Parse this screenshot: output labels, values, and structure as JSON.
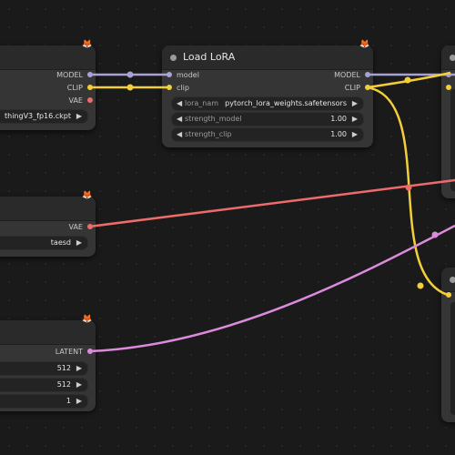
{
  "colors": {
    "model": "#a8a2d4",
    "clip": "#f2cf3a",
    "vae": "#ee6b6b",
    "latent": "#dc8bdc",
    "canvas": "#1a1a1a",
    "node": "#353535"
  },
  "icons": {
    "node_badge": "fox-icon"
  },
  "checkpoint_node": {
    "outputs": {
      "model": "MODEL",
      "clip": "CLIP",
      "vae": "VAE"
    },
    "ckpt_value": "thingV3_fp16.ckpt"
  },
  "lora_node": {
    "title": "Load LoRA",
    "inputs": {
      "model": "model",
      "clip": "clip"
    },
    "outputs": {
      "model": "MODEL",
      "clip": "CLIP"
    },
    "widgets": {
      "lora_name": {
        "label": "lora_nam",
        "value": "pytorch_lora_weights.safetensors"
      },
      "strength_model": {
        "label": "strength_model",
        "value": "1.00"
      },
      "strength_clip": {
        "label": "strength_clip",
        "value": "1.00"
      }
    }
  },
  "vae_node": {
    "outputs": {
      "vae": "VAE"
    },
    "vae_value": "taesd"
  },
  "latent_node": {
    "outputs": {
      "latent": "LATENT"
    },
    "width": "512",
    "height": "512",
    "batch": "1"
  }
}
